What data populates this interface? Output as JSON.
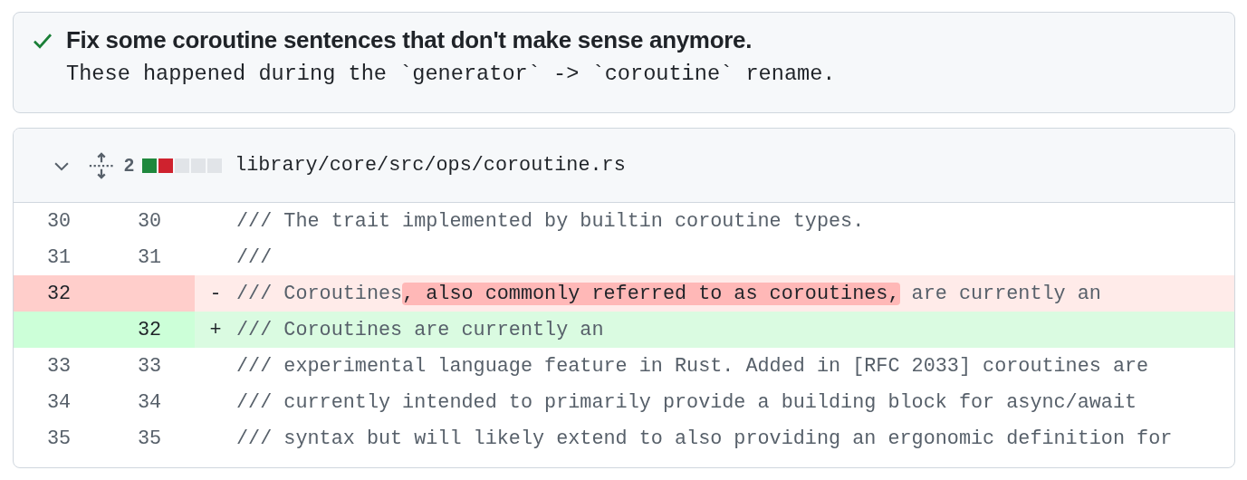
{
  "commit": {
    "verified": true,
    "title": "Fix some coroutine sentences that don't make sense anymore.",
    "message": "These happened during the `generator` -> `coroutine` rename."
  },
  "file": {
    "expanded": true,
    "changes": "2",
    "stat": [
      {
        "kind": "add"
      },
      {
        "kind": "del"
      },
      {
        "kind": "none"
      },
      {
        "kind": "none"
      },
      {
        "kind": "none"
      }
    ],
    "path": "library/core/src/ops/coroutine.rs",
    "lines": [
      {
        "kind": "context",
        "old": "30",
        "new": "30",
        "code": [
          {
            "text": "/// The trait implemented by builtin coroutine types.",
            "changed": false
          }
        ]
      },
      {
        "kind": "context",
        "old": "31",
        "new": "31",
        "code": [
          {
            "text": "///",
            "changed": false
          }
        ]
      },
      {
        "kind": "del",
        "old": "32",
        "sign": "-",
        "code": [
          {
            "text": "/// Coroutines",
            "changed": false
          },
          {
            "text": ", also commonly referred to as coroutines,",
            "changed": true
          },
          {
            "text": " are currently an",
            "changed": false
          }
        ]
      },
      {
        "kind": "add",
        "new": "32",
        "sign": "+",
        "code": [
          {
            "text": "/// Coroutines are currently an",
            "changed": false
          }
        ]
      },
      {
        "kind": "context",
        "old": "33",
        "new": "33",
        "code": [
          {
            "text": "/// experimental language feature in Rust. Added in [RFC 2033] coroutines are",
            "changed": false
          }
        ]
      },
      {
        "kind": "context",
        "old": "34",
        "new": "34",
        "code": [
          {
            "text": "/// currently intended to primarily provide a building block for async/await",
            "changed": false
          }
        ]
      },
      {
        "kind": "context",
        "old": "35",
        "new": "35",
        "code": [
          {
            "text": "/// syntax but will likely extend to also providing an ergonomic definition for",
            "changed": false
          }
        ]
      }
    ]
  }
}
